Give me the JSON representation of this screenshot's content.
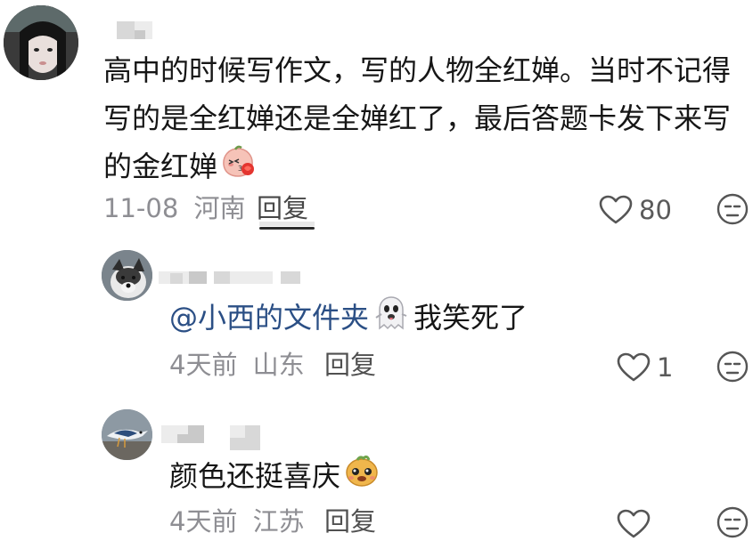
{
  "comments": [
    {
      "text_lines": [
        "高中的时候写作文，写的人物全红婵。当时不记得",
        "写的是全红婵还是全婵红了，最后答题卡发下来写",
        "的金红婵"
      ],
      "time": "11-08",
      "location": "河南",
      "reply_label": "回复",
      "likes": "80",
      "emoji": "peach-blush-emoji"
    }
  ],
  "replies": [
    {
      "mention": "@小西的文件夹",
      "emoji": "ghost-emoji",
      "text": "我笑死了",
      "time": "4天前",
      "location": "山东",
      "reply_label": "回复",
      "likes": "1"
    },
    {
      "text": "颜色还挺喜庆",
      "emoji": "sweet-potato-face-emoji",
      "time": "4天前",
      "location": "江苏",
      "reply_label": "回复",
      "likes": ""
    }
  ],
  "icons": {
    "like": "heart-outline-icon",
    "dislike": "unamused-face-icon"
  },
  "colors": {
    "mention": "#2b4f85",
    "meta": "#8e8e93",
    "text": "#161616"
  }
}
